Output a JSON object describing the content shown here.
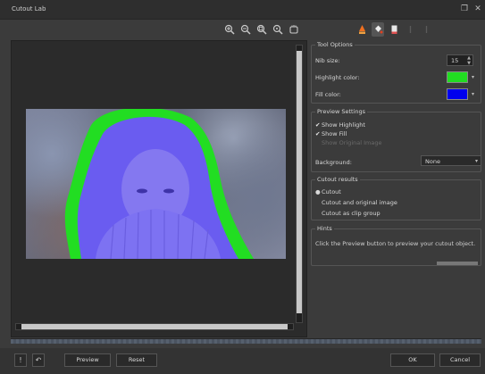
{
  "window": {
    "title": "Cutout Lab",
    "restore_glyph": "❐",
    "close_glyph": "✕"
  },
  "zoom_toolbar": {
    "icons": [
      "zoom-in-icon",
      "zoom-out-icon",
      "zoom-fit-icon",
      "zoom-actual-icon",
      "hand-pan-icon"
    ]
  },
  "tools": {
    "icons": [
      "highlight-brush-icon",
      "fill-bucket-icon",
      "eraser-icon",
      "undo-icon",
      "redo-icon"
    ]
  },
  "tool_options": {
    "legend": "Tool Options",
    "nib_size_label": "Nib size:",
    "nib_size_value": "15",
    "highlight_color_label": "Highlight color:",
    "highlight_color": "#22dd22",
    "fill_color_label": "Fill color:",
    "fill_color": "#0000ee"
  },
  "preview_settings": {
    "legend": "Preview Settings",
    "show_highlight": "Show Highlight",
    "show_fill": "Show Fill",
    "disabled_option": "Show Original Image",
    "background_label": "Background:",
    "background_value": "None"
  },
  "cutout_results": {
    "legend": "Cutout results",
    "options": [
      "Cutout",
      "Cutout and original image",
      "Cutout as clip group"
    ]
  },
  "hints": {
    "legend": "Hints",
    "text": "Click the Preview button to preview your cutout object."
  },
  "bottom": {
    "preview_label": "Preview",
    "reset_label": "Reset",
    "ok_label": "OK",
    "cancel_label": "Cancel"
  }
}
